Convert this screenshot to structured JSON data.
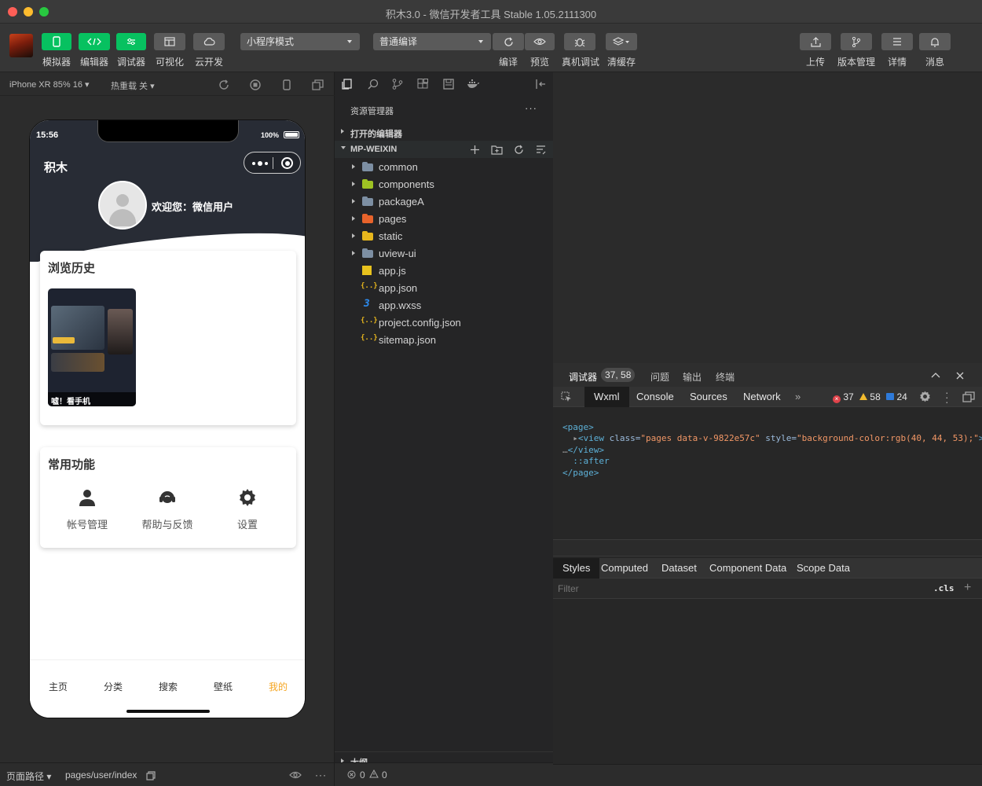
{
  "window": {
    "title": "积木3.0 - 微信开发者工具 Stable 1.05.2111300"
  },
  "toolbar": {
    "simulator": "模拟器",
    "editor": "编辑器",
    "debugger": "调试器",
    "visual": "可视化",
    "cloud": "云开发",
    "mode_select": "小程序模式",
    "compile_select": "普通编译",
    "compile": "编译",
    "preview": "预览",
    "remote_debug": "真机调试",
    "clear_cache": "清缓存",
    "upload": "上传",
    "version": "版本管理",
    "details": "详情",
    "messages": "消息",
    "accent_green": "#07c160"
  },
  "simulator": {
    "device": "iPhone XR 85% 16",
    "hotreload": "热重载 关",
    "status_time": "15:56",
    "battery": "100%",
    "app_name": "积木",
    "welcome": "欢迎您：微信用户",
    "history_title": "浏览历史",
    "history_item_caption": "嘘！看手机",
    "functions_title": "常用功能",
    "functions": [
      "帐号管理",
      "帮助与反馈",
      "设置"
    ],
    "tabs": [
      "主页",
      "分类",
      "搜索",
      "壁纸",
      "我的"
    ],
    "active_tab_color": "#f5a623",
    "header_bg": "#282c35"
  },
  "statusbar_left": {
    "path_label": "页面路径",
    "path": "pages/user/index"
  },
  "explorer": {
    "title": "资源管理器",
    "more": "···",
    "open_editors": "打开的编辑器",
    "project": "MP-WEIXIN",
    "items": [
      {
        "name": "common",
        "type": "folder",
        "color": "#7d8fa3"
      },
      {
        "name": "components",
        "type": "folder",
        "color": "#9ec323"
      },
      {
        "name": "packageA",
        "type": "folder",
        "color": "#7d8fa3"
      },
      {
        "name": "pages",
        "type": "folder",
        "color": "#e8632b"
      },
      {
        "name": "static",
        "type": "folder",
        "color": "#e8b71d"
      },
      {
        "name": "uview-ui",
        "type": "folder",
        "color": "#7d8fa3"
      },
      {
        "name": "app.js",
        "type": "js"
      },
      {
        "name": "app.json",
        "type": "json"
      },
      {
        "name": "app.wxss",
        "type": "css"
      },
      {
        "name": "project.config.json",
        "type": "json"
      },
      {
        "name": "sitemap.json",
        "type": "json"
      }
    ],
    "outline": "大纲",
    "errors": "0",
    "warnings": "0"
  },
  "debugger": {
    "tabs": [
      "调试器",
      "问题",
      "输出",
      "终端"
    ],
    "position": "37, 58",
    "devtools_tabs": [
      "Wxml",
      "Console",
      "Sources",
      "Network"
    ],
    "more_tabs": "»",
    "error_count": "37",
    "warning_count": "58",
    "info_count": "24",
    "code": {
      "line1_tag": "<page>",
      "line2_open": "<view",
      "line2_attr1": " class=",
      "line2_val1": "\"pages data-v-9822e57c\"",
      "line2_attr2": " style=",
      "line2_val2": "\"background-color:rgb(40, 44, 53);\"",
      "line2_close": ">",
      "line3_ell": "…",
      "line3_tag": "</view>",
      "line4": "::after",
      "line5": "</page>"
    },
    "style_tabs": [
      "Styles",
      "Computed",
      "Dataset",
      "Component Data",
      "Scope Data"
    ],
    "filter_placeholder": "Filter",
    "cls": ".cls",
    "plus": "+"
  }
}
